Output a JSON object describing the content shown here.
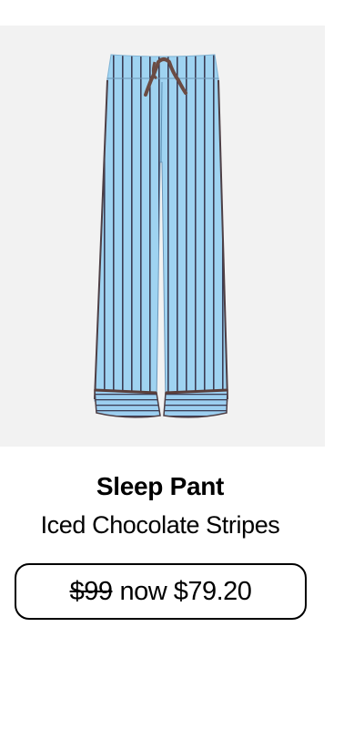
{
  "product": {
    "name": "Sleep Pant",
    "color": "Iced Chocolate Stripes",
    "price_original": "$99",
    "price_sale": "now $79.20"
  },
  "image": {
    "icon": "pajama-pants-image",
    "background": "#f2f2f2",
    "fabric": "#9ed3f1",
    "stripe": "#3a3b52",
    "drawstring": "#6b4b43"
  }
}
